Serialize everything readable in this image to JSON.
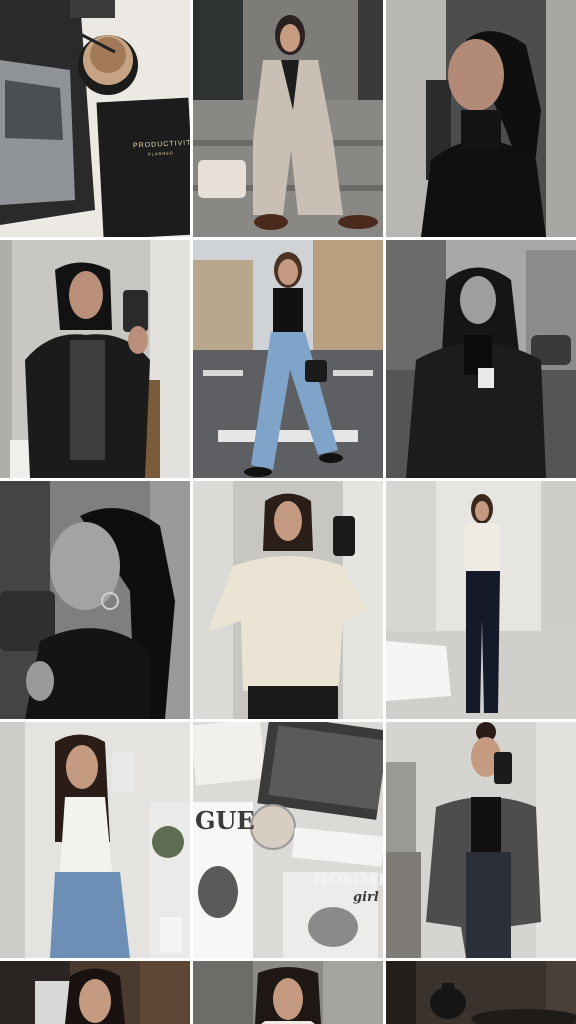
{
  "feed": {
    "posts": [
      {
        "id": "p1",
        "caption": "productivity desk with iced coffee",
        "notebook_title": "PRODUCTIVITY",
        "notebook_sub": "PLANNER"
      },
      {
        "id": "p2",
        "caption": "beige suit on steps"
      },
      {
        "id": "p3",
        "caption": "black turtleneck portrait"
      },
      {
        "id": "p4",
        "caption": "mirror selfie black blazer"
      },
      {
        "id": "p5",
        "caption": "street crossing jeans"
      },
      {
        "id": "p6",
        "caption": "leather coat coffee street bw"
      },
      {
        "id": "p7",
        "caption": "bw profile hoop earring"
      },
      {
        "id": "p8",
        "caption": "cream knit mirror selfie"
      },
      {
        "id": "p9",
        "caption": "white top navy trousers"
      },
      {
        "id": "p10",
        "caption": "white tank jeans mirror selfie"
      },
      {
        "id": "p11",
        "caption": "magazines flatlay",
        "mag_label_1": "GUE",
        "mag_label_2": "HOMME",
        "mag_label_3": "girl"
      },
      {
        "id": "p12",
        "caption": "grey blazer mirror selfie"
      },
      {
        "id": "p13",
        "caption": "row5 portrait"
      },
      {
        "id": "p14",
        "caption": "row5 coat portrait"
      },
      {
        "id": "p15",
        "caption": "row5 dark interior"
      }
    ]
  },
  "colors": {
    "background": "#ffffff",
    "tile_placeholder": "#d9d9d9"
  }
}
